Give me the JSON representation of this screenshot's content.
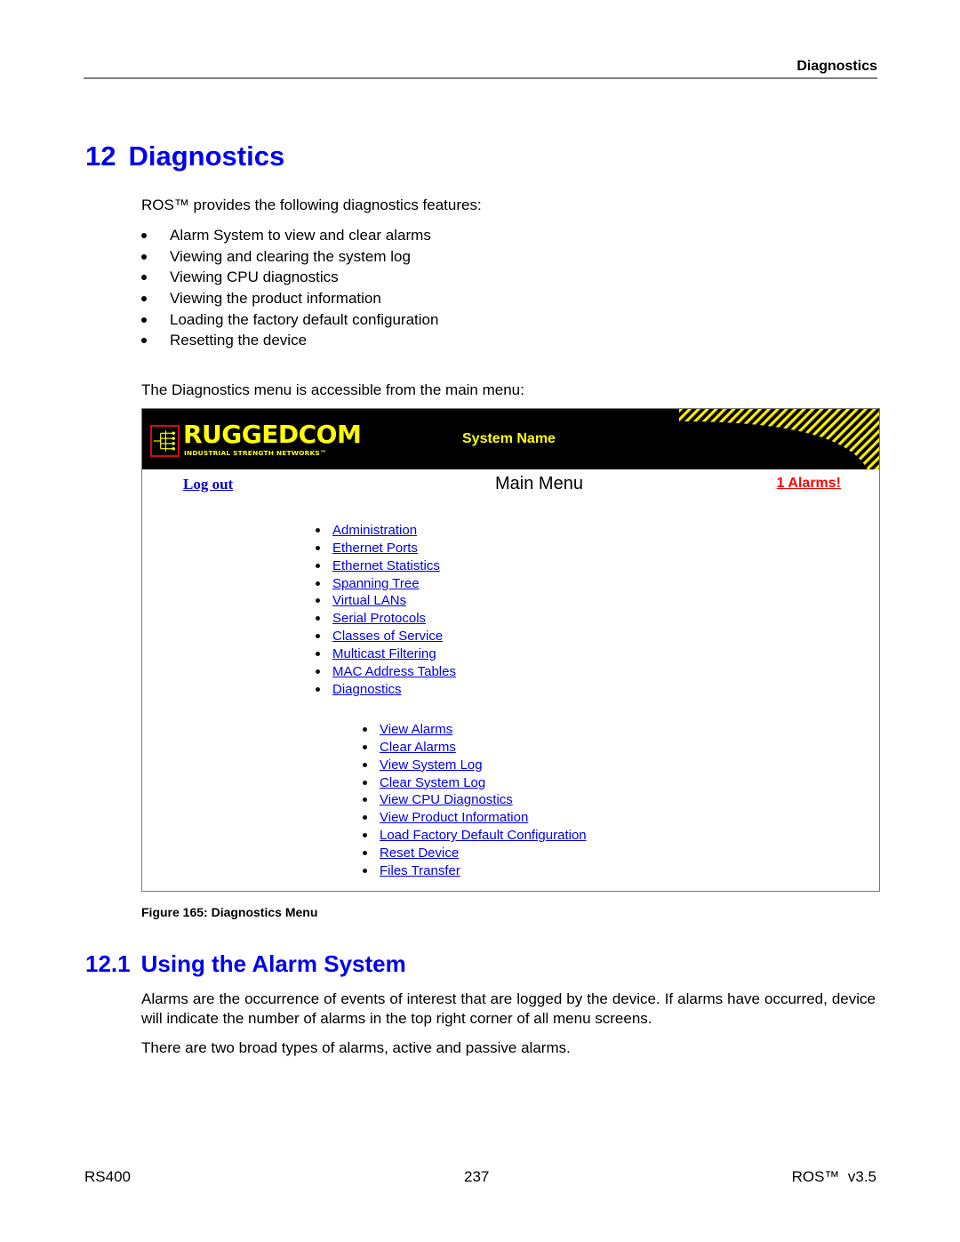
{
  "running_header": "Diagnostics",
  "chapter": {
    "number": "12",
    "title": "Diagnostics"
  },
  "intro": "ROS™ provides the following diagnostics features:",
  "features": [
    "Alarm System to view and clear alarms",
    "Viewing and clearing the system log",
    "Viewing CPU diagnostics",
    "Viewing the product information",
    "Loading the factory default configuration",
    "Resetting the device"
  ],
  "menu_intro": "The Diagnostics menu is accessible from the main menu:",
  "screenshot": {
    "brand": "RUGGEDCOM",
    "tagline": "INDUSTRIAL STRENGTH NETWORKS™",
    "system_name": "System Name",
    "logout": "Log out",
    "title": "Main Menu",
    "alarms": "1 Alarms!",
    "colors": {
      "header_bg": "#000000",
      "brand": "#ffff00",
      "link": "#0000ee",
      "alarm": "#ff0000"
    },
    "main_menu": [
      "Administration",
      "Ethernet Ports",
      "Ethernet Statistics",
      "Spanning Tree",
      "Virtual LANs",
      "Serial Protocols",
      "Classes of Service",
      "Multicast Filtering",
      "MAC Address Tables",
      "Diagnostics"
    ],
    "diagnostics_menu": [
      "View Alarms",
      "Clear Alarms",
      "View System Log",
      "Clear System Log",
      "View CPU Diagnostics",
      "View Product Information",
      "Load Factory Default Configuration",
      "Reset Device",
      "Files Transfer"
    ]
  },
  "figure_caption": "Figure 165: Diagnostics Menu",
  "section": {
    "number": "12.1",
    "title": "Using the Alarm System"
  },
  "paragraphs": [
    "Alarms are the occurrence of events of interest that are logged by the device. If alarms have occurred, device will indicate the number of alarms in the top right corner of all menu screens.",
    "There are two broad types of alarms, active and passive alarms."
  ],
  "footer": {
    "left": "RS400",
    "center": "237",
    "right": "ROS™  v3.5"
  }
}
